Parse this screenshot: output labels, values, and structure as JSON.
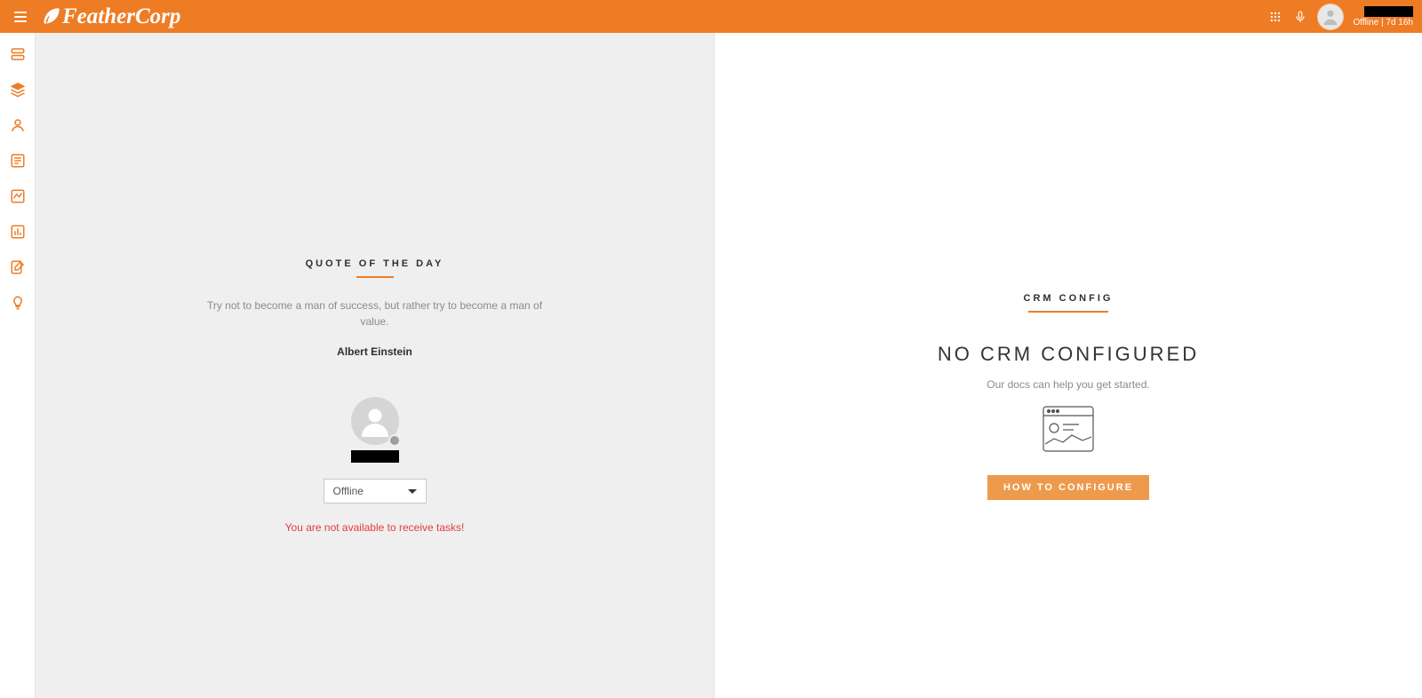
{
  "header": {
    "brand": "FeatherCorp",
    "user_status": "Offline | 7d 16h"
  },
  "sidebar": {
    "items": [
      {
        "name": "sidebar-item-1"
      },
      {
        "name": "sidebar-item-2"
      },
      {
        "name": "sidebar-item-3"
      },
      {
        "name": "sidebar-item-4"
      },
      {
        "name": "sidebar-item-5"
      },
      {
        "name": "sidebar-item-6"
      },
      {
        "name": "sidebar-item-7"
      },
      {
        "name": "sidebar-item-8"
      }
    ]
  },
  "left_panel": {
    "section_title": "QUOTE OF THE DAY",
    "quote": "Try not to become a man of success, but rather try to become a man of value.",
    "author": "Albert Einstein",
    "status_value": "Offline",
    "warning": "You are not available to receive tasks!"
  },
  "right_panel": {
    "section_title": "CRM CONFIG",
    "heading": "NO CRM CONFIGURED",
    "subtext": "Our docs can help you get started.",
    "button_label": "HOW TO CONFIGURE"
  },
  "colors": {
    "accent": "#ee7c24",
    "warn": "#e23c3c"
  }
}
